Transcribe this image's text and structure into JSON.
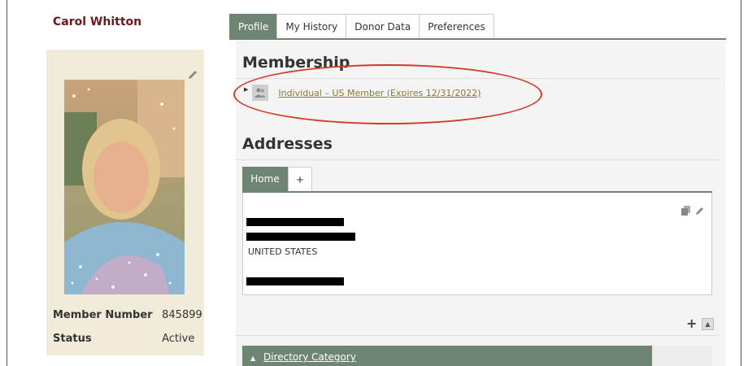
{
  "member": {
    "name": "Carol Whitton",
    "info": [
      {
        "label": "Member Number",
        "value": "845899"
      },
      {
        "label": "Status",
        "value": "Active"
      }
    ]
  },
  "tabs": [
    "Profile",
    "My History",
    "Donor Data",
    "Preferences"
  ],
  "active_tab": "Profile",
  "membership": {
    "title": "Membership",
    "link": "Individual – US Member (Expires 12/31/2022)"
  },
  "addresses": {
    "title": "Addresses",
    "tabs": {
      "home": "Home",
      "add": "+"
    },
    "country": "UNITED STATES"
  },
  "directory": {
    "arrow": "▲",
    "link": "Directory Category"
  },
  "colors": {
    "accent": "#6f8574",
    "name": "#6b1a1a",
    "link": "#8a7a2e",
    "annotation": "#d23a2a",
    "card": "#f1ecd9"
  },
  "icons": [
    "edit-pencil-icon",
    "member-group-icon",
    "copy-icon",
    "plus-icon",
    "collapse-up-icon"
  ]
}
